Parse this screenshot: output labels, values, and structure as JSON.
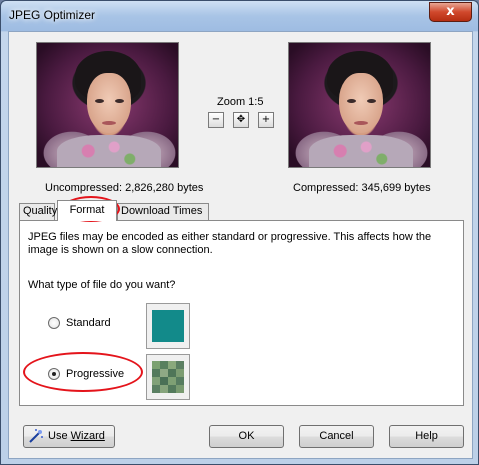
{
  "window": {
    "title": "JPEG Optimizer",
    "close_glyph": "x"
  },
  "zoom": {
    "label": "Zoom 1:5",
    "buttons": [
      {
        "name": "zoom-out-icon",
        "glyph": "−"
      },
      {
        "name": "pan-icon",
        "glyph": "✥"
      },
      {
        "name": "zoom-in-icon",
        "glyph": "+"
      }
    ]
  },
  "captions": {
    "uncompressed": "Uncompressed:  2,826,280 bytes",
    "compressed": "Compressed: 345,699 bytes"
  },
  "tabs": [
    {
      "label": "Quality",
      "active": false
    },
    {
      "label": "Format",
      "active": true
    },
    {
      "label": "Download Times",
      "active": false
    }
  ],
  "format_panel": {
    "description": "JPEG files may be encoded as either standard or progressive. This affects how the image is shown on a slow connection.",
    "question": "What type of file do you want?",
    "options": [
      {
        "label": "Standard",
        "checked": false,
        "swatch_color": "#128a8a"
      },
      {
        "label": "Progressive",
        "checked": true
      }
    ]
  },
  "buttons": {
    "wizard_prefix": "Use ",
    "wizard_label": "Wizard",
    "ok": "OK",
    "cancel": "Cancel",
    "help": "Help"
  },
  "annotation_color": "#e4141b"
}
